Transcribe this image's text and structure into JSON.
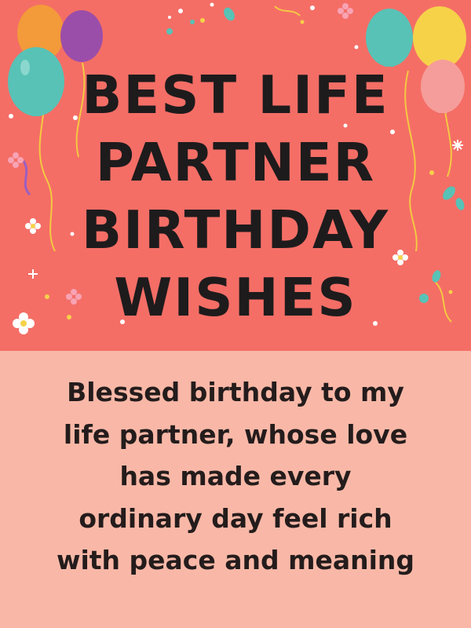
{
  "title": {
    "lines": [
      "BEST LIFE",
      "PARTNER",
      "BIRTHDAY",
      "WISHES"
    ]
  },
  "wish": {
    "text": "Blessed birthday to my life partner, whose love has made every ordinary day feel rich with peace and meaning"
  },
  "colors": {
    "hero_background": "#f46e66",
    "wish_background": "#f9b8a7",
    "text": "#1e1b1c"
  },
  "decorations": [
    "balloon-icon",
    "confetti-dot-icon",
    "flower-icon",
    "sparkle-icon",
    "streamer-icon"
  ]
}
